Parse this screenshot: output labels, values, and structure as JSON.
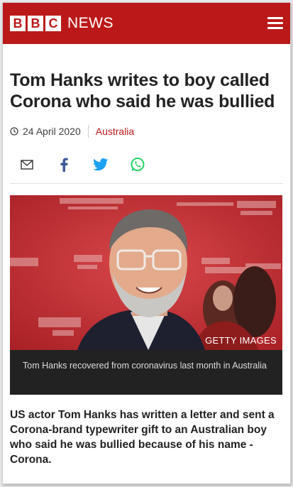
{
  "header": {
    "logo_letters": [
      "B",
      "B",
      "C"
    ],
    "logo_word": "NEWS",
    "brand_color": "#bb1919",
    "menu_icon": "hamburger-menu-icon"
  },
  "article": {
    "title": "Tom Hanks writes to boy called Corona who said he was bullied",
    "date": "24 April 2020",
    "section": "Australia",
    "share_icons": [
      "email-icon",
      "facebook-icon",
      "twitter-icon",
      "whatsapp-icon"
    ],
    "image": {
      "credit": "GETTY IMAGES",
      "caption": "Tom Hanks recovered from coronavirus last month in Australia"
    },
    "lead": "US actor Tom Hanks has written a letter and sent a Corona-brand typewriter gift to an Australian boy who said he was bullied because of his name - Corona."
  }
}
